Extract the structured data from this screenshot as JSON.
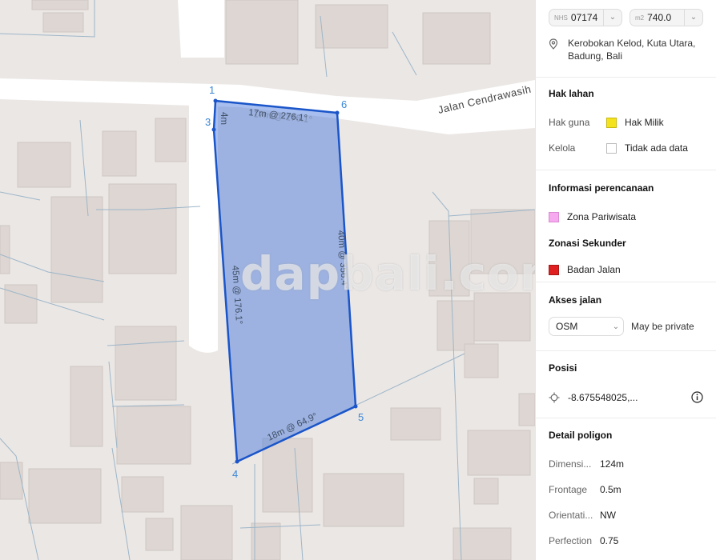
{
  "map": {
    "road_name": "Jalan Cendrawasih",
    "watermark": "dapbali.com",
    "vertices": [
      "1",
      "3",
      "4",
      "5",
      "6"
    ],
    "edge_labels": [
      "17m @ 276.1°",
      "4m",
      "45m @ 176.1°",
      "18m @ 64.9°",
      "40m @ 356.4°"
    ],
    "edge_label_overlap": "17m @ 276.1°"
  },
  "panel": {
    "nib": {
      "prefix": "NHS",
      "value": "07174"
    },
    "area": {
      "prefix": "m2",
      "value": "740.0"
    },
    "address": "Kerobokan Kelod, Kuta Utara, Badung, Bali",
    "hak_lahan": {
      "title": "Hak lahan",
      "rows": [
        {
          "label": "Hak guna",
          "value": "Hak Milik",
          "color": "#f3e21c"
        },
        {
          "label": "Kelola",
          "value": "Tidak ada data",
          "color": "#ffffff"
        }
      ]
    },
    "perencanaan": {
      "title": "Informasi perencanaan",
      "zone": {
        "value": "Zona Pariwisata",
        "color": "#f7a9f0"
      },
      "secondary_title": "Zonasi Sekunder",
      "secondary": {
        "value": "Badan Jalan",
        "color": "#e02020"
      }
    },
    "akses": {
      "title": "Akses jalan",
      "select": "OSM",
      "note": "May be private"
    },
    "posisi": {
      "title": "Posisi",
      "value": "-8.675548025,..."
    },
    "detail": {
      "title": "Detail poligon",
      "rows": [
        {
          "label": "Dimensi...",
          "value": "124m"
        },
        {
          "label": "Frontage",
          "value": "0.5m"
        },
        {
          "label": "Orientati...",
          "value": "NW"
        },
        {
          "label": "Perfection",
          "value": "0.75"
        }
      ]
    }
  }
}
